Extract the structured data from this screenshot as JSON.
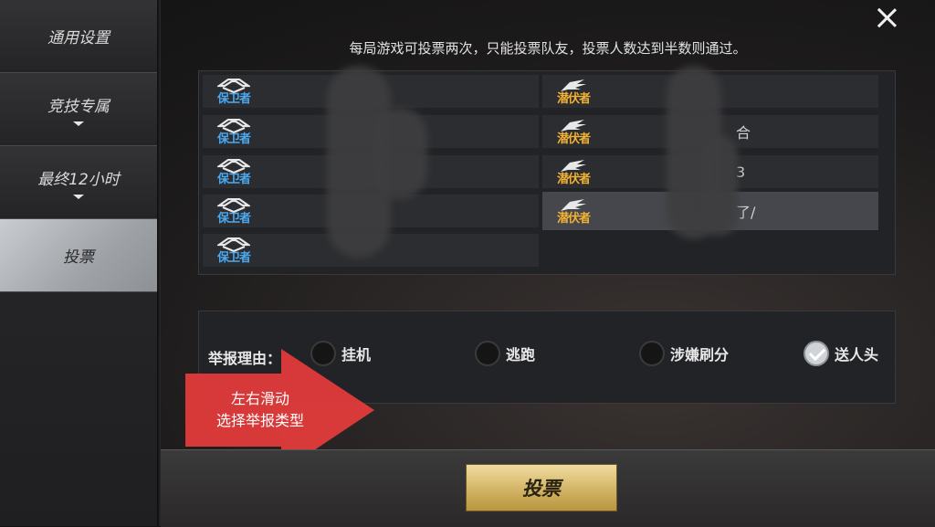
{
  "sidebar": {
    "items": [
      {
        "label": "通用设置"
      },
      {
        "label": "竞技专属"
      },
      {
        "label": "最终12小时"
      },
      {
        "label": "投票"
      }
    ]
  },
  "notice": "每局游戏可投票两次，只能投票队友，投票人数达到半数则通过。",
  "teams": {
    "defender_label": "保卫者",
    "lurker_label": "潜伏者"
  },
  "players": {
    "left": [
      "",
      "",
      "",
      "",
      ""
    ],
    "right": [
      "",
      "合",
      "3",
      "了/"
    ]
  },
  "report": {
    "label": "举报理由：",
    "reasons": [
      {
        "label": "挂机",
        "checked": false
      },
      {
        "label": "逃跑",
        "checked": false
      },
      {
        "label": "涉嫌刷分",
        "checked": false
      },
      {
        "label": "送人头",
        "checked": true
      }
    ]
  },
  "hint": {
    "line1": "左右滑动",
    "line2": "选择举报类型"
  },
  "vote_button": "投票",
  "colors": {
    "defender": "#4aa9f0",
    "lurker": "#f3b234",
    "hint_arrow": "#e23b3b",
    "vote_gold": "#d5b76a"
  }
}
